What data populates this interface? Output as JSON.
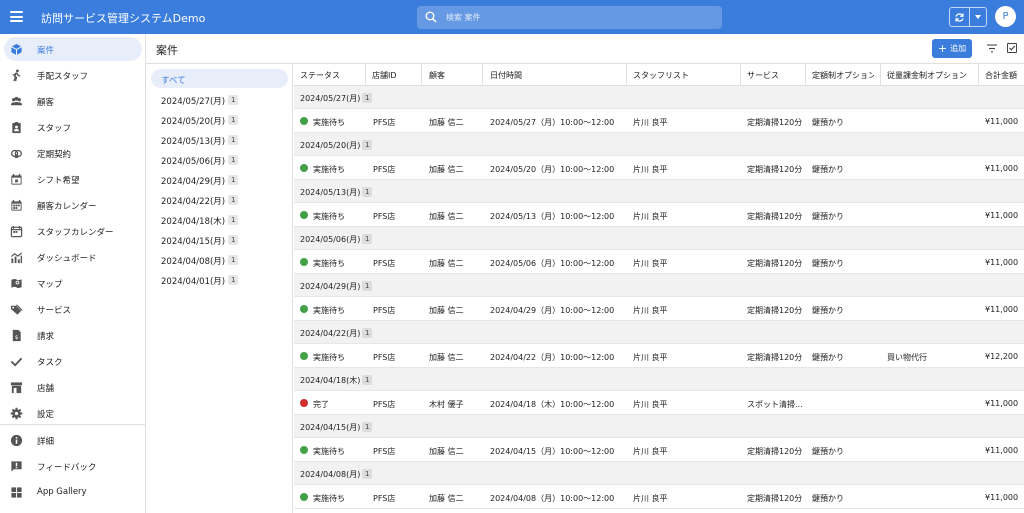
{
  "app": {
    "title": "訪問サービス管理システムDemo",
    "user_initial": "P"
  },
  "search": {
    "placeholder": "検索 案件"
  },
  "colors": {
    "accent": "#3b7ddd",
    "status_pending": "#43a047",
    "status_done": "#d32f2f"
  },
  "sidebar": {
    "items": [
      {
        "label": "案件",
        "icon": "cube-icon",
        "active": true
      },
      {
        "label": "手配スタッフ",
        "icon": "walking-person-icon"
      },
      {
        "label": "顧客",
        "icon": "people-icon"
      },
      {
        "label": "スタッフ",
        "icon": "id-badge-icon"
      },
      {
        "label": "定期契約",
        "icon": "recurring-contract-icon"
      },
      {
        "label": "シフト希望",
        "icon": "calendar-check-icon"
      },
      {
        "label": "顧客カレンダー",
        "icon": "calendar-icon"
      },
      {
        "label": "スタッフカレンダー",
        "icon": "calendar-grid-icon"
      },
      {
        "label": "ダッシュボード",
        "icon": "chart-icon"
      },
      {
        "label": "マップ",
        "icon": "map-icon"
      },
      {
        "label": "サービス",
        "icon": "tag-icon"
      },
      {
        "label": "請求",
        "icon": "invoice-icon"
      },
      {
        "label": "タスク",
        "icon": "checkmark-icon"
      },
      {
        "label": "店舗",
        "icon": "store-icon"
      },
      {
        "label": "設定",
        "icon": "gear-icon"
      }
    ],
    "footer_items": [
      {
        "label": "詳細",
        "icon": "info-icon"
      },
      {
        "label": "フィードバック",
        "icon": "feedback-icon"
      },
      {
        "label": "App Gallery",
        "icon": "grid-icon"
      }
    ]
  },
  "page": {
    "title": "案件",
    "add_label": "追加"
  },
  "groups": [
    {
      "label": "すべて",
      "active": true
    },
    {
      "label": "2024/05/27(月)",
      "count": "1"
    },
    {
      "label": "2024/05/20(月)",
      "count": "1"
    },
    {
      "label": "2024/05/13(月)",
      "count": "1"
    },
    {
      "label": "2024/05/06(月)",
      "count": "1"
    },
    {
      "label": "2024/04/29(月)",
      "count": "1"
    },
    {
      "label": "2024/04/22(月)",
      "count": "1"
    },
    {
      "label": "2024/04/18(木)",
      "count": "1"
    },
    {
      "label": "2024/04/15(月)",
      "count": "1"
    },
    {
      "label": "2024/04/08(月)",
      "count": "1"
    },
    {
      "label": "2024/04/01(月)",
      "count": "1"
    }
  ],
  "table": {
    "columns": [
      "ステータス",
      "店舗ID",
      "顧客",
      "日付時間",
      "スタッフリスト",
      "サービス",
      "定額制オプション",
      "従量課金制オプション",
      "合計金額"
    ],
    "groups": [
      {
        "label": "2024/05/27(月)",
        "count": "1",
        "row": {
          "status": "実施待ち",
          "status_kind": "pending",
          "store": "PFS店",
          "customer": "加藤 信二",
          "datetime": "2024/05/27（月）10:00〜12:00",
          "staff": "片川 良平",
          "service": "定期清掃120分",
          "fixed_option": "鍵預かり",
          "metered_option": "",
          "total": "¥11,000"
        }
      },
      {
        "label": "2024/05/20(月)",
        "count": "1",
        "row": {
          "status": "実施待ち",
          "status_kind": "pending",
          "store": "PFS店",
          "customer": "加藤 信二",
          "datetime": "2024/05/20（月）10:00〜12:00",
          "staff": "片川 良平",
          "service": "定期清掃120分",
          "fixed_option": "鍵預かり",
          "metered_option": "",
          "total": "¥11,000"
        }
      },
      {
        "label": "2024/05/13(月)",
        "count": "1",
        "row": {
          "status": "実施待ち",
          "status_kind": "pending",
          "store": "PFS店",
          "customer": "加藤 信二",
          "datetime": "2024/05/13（月）10:00〜12:00",
          "staff": "片川 良平",
          "service": "定期清掃120分",
          "fixed_option": "鍵預かり",
          "metered_option": "",
          "total": "¥11,000"
        }
      },
      {
        "label": "2024/05/06(月)",
        "count": "1",
        "row": {
          "status": "実施待ち",
          "status_kind": "pending",
          "store": "PFS店",
          "customer": "加藤 信二",
          "datetime": "2024/05/06（月）10:00〜12:00",
          "staff": "片川 良平",
          "service": "定期清掃120分",
          "fixed_option": "鍵預かり",
          "metered_option": "",
          "total": "¥11,000"
        }
      },
      {
        "label": "2024/04/29(月)",
        "count": "1",
        "row": {
          "status": "実施待ち",
          "status_kind": "pending",
          "store": "PFS店",
          "customer": "加藤 信二",
          "datetime": "2024/04/29（月）10:00〜12:00",
          "staff": "片川 良平",
          "service": "定期清掃120分",
          "fixed_option": "鍵預かり",
          "metered_option": "",
          "total": "¥11,000"
        }
      },
      {
        "label": "2024/04/22(月)",
        "count": "1",
        "row": {
          "status": "実施待ち",
          "status_kind": "pending",
          "store": "PFS店",
          "customer": "加藤 信二",
          "datetime": "2024/04/22（月）10:00〜12:00",
          "staff": "片川 良平",
          "service": "定期清掃120分",
          "fixed_option": "鍵預かり",
          "metered_option": "買い物代行",
          "total": "¥12,200"
        }
      },
      {
        "label": "2024/04/18(木)",
        "count": "1",
        "row": {
          "status": "完了",
          "status_kind": "done",
          "store": "PFS店",
          "customer": "木村 優子",
          "datetime": "2024/04/18（木）10:00〜12:00",
          "staff": "片川 良平",
          "service": "スポット清掃...",
          "fixed_option": "",
          "metered_option": "",
          "total": "¥11,000"
        }
      },
      {
        "label": "2024/04/15(月)",
        "count": "1",
        "row": {
          "status": "実施待ち",
          "status_kind": "pending",
          "store": "PFS店",
          "customer": "加藤 信二",
          "datetime": "2024/04/15（月）10:00〜12:00",
          "staff": "片川 良平",
          "service": "定期清掃120分",
          "fixed_option": "鍵預かり",
          "metered_option": "",
          "total": "¥11,000"
        }
      },
      {
        "label": "2024/04/08(月)",
        "count": "1",
        "row": {
          "status": "実施待ち",
          "status_kind": "pending",
          "store": "PFS店",
          "customer": "加藤 信二",
          "datetime": "2024/04/08（月）10:00〜12:00",
          "staff": "片川 良平",
          "service": "定期清掃120分",
          "fixed_option": "鍵預かり",
          "metered_option": "",
          "total": "¥11,000"
        }
      }
    ]
  }
}
